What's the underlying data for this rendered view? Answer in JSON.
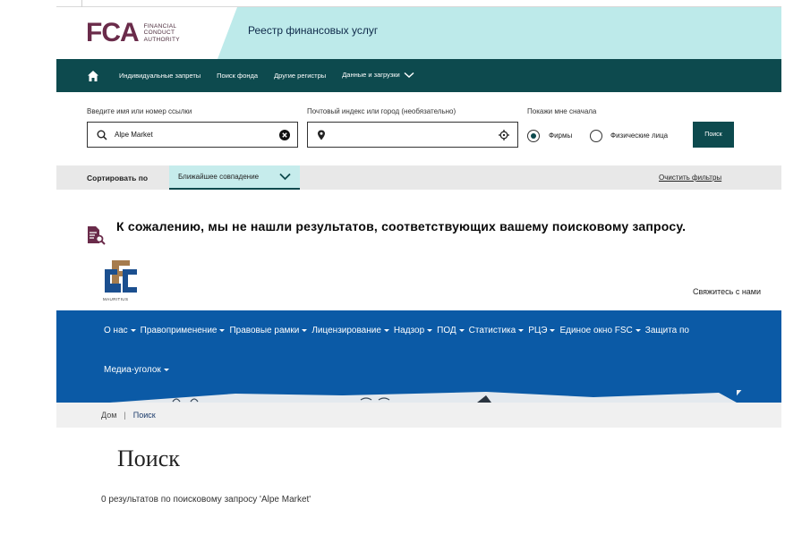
{
  "fca": {
    "logo_mark": "FCA",
    "logo_words": [
      "FINANCIAL",
      "CONDUCT",
      "AUTHORITY"
    ],
    "title": "Реестр финансовых услуг",
    "nav": {
      "items": [
        "Индивидуальные запреты",
        "Поиск фонда",
        "Другие регистры",
        "Данные и загрузки"
      ]
    },
    "search": {
      "name_label": "Введите имя или номер ссылки",
      "name_value": "Alpe Market",
      "location_label": "Почтовый индекс или город (необязательно)",
      "location_value": "",
      "show_first_label": "Покажи мне сначала",
      "option_firms": "Фирмы",
      "option_individuals": "Физические лица",
      "selected": "Фирмы",
      "button": "Поиск"
    },
    "sort": {
      "label": "Сортировать по",
      "selected": "Ближайшее совпадение",
      "clear": "Очистить фильтры"
    },
    "no_results": "К сожалению, мы не нашли результатов, соответствующих вашему поисковому запросу."
  },
  "fsc": {
    "logo_caption": "MAURITIUS",
    "contact": "Свяжитесь с нами",
    "nav_row1": [
      "О нас",
      "Правоприменение",
      "Правовые рамки",
      "Лицензирование",
      "Надзор",
      "ПОД",
      "Статистика",
      "РЦЭ",
      "Единое окно FSC",
      "Защита по"
    ],
    "nav_row2": [
      "Медиа-уголок"
    ],
    "breadcrumb": {
      "home": "Дом",
      "separator": "|",
      "current": "Поиск"
    },
    "page_title": "Поиск",
    "results_count": "0 результатов по поисковому запросу 'Alpe Market'"
  },
  "colors": {
    "fca_teal": "#0d4a4e",
    "fca_band": "#bdeaea",
    "fca_purple": "#6a2b4a",
    "fsc_blue": "#0b5aa6"
  }
}
